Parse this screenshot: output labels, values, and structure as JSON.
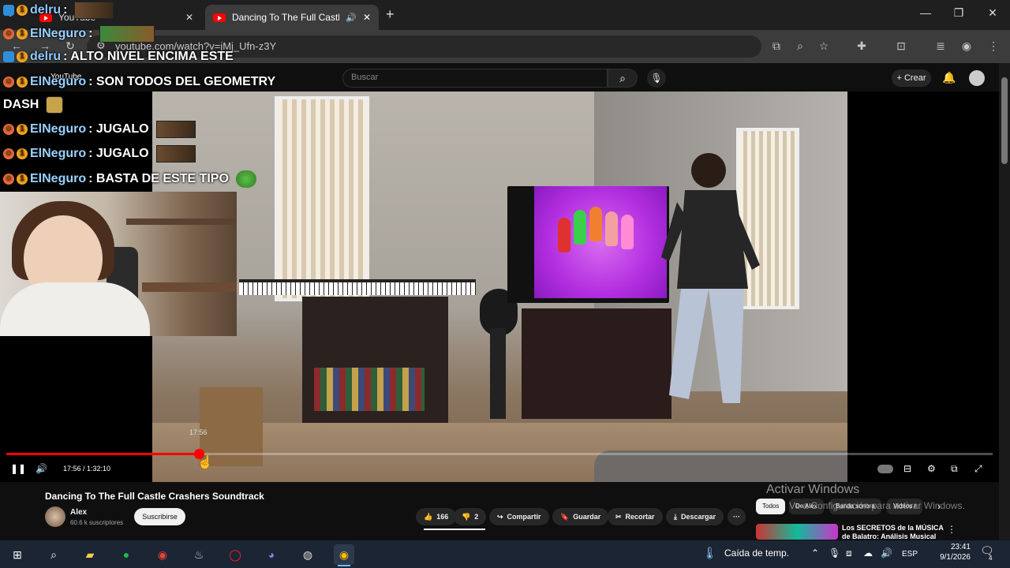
{
  "browser": {
    "tabs": [
      {
        "title": "YouTube"
      },
      {
        "title": "Dancing To The Full Castle C"
      }
    ],
    "new_tab": "+",
    "url": "youtube.com/watch?v=jMj_Ufn-z3Y"
  },
  "youtube": {
    "logo_text": "YouTube",
    "search_placeholder": "Buscar",
    "create_label": "Crear"
  },
  "chat": [
    {
      "user": "delru",
      "msg": ":"
    },
    {
      "user": "ElNeguro",
      "msg": ":"
    },
    {
      "user": "delru",
      "msg": ": ALTO NIVEL ENCIMA ESTE"
    },
    {
      "user": "ElNeguro",
      "msg": ": SON TODOS DEL GEOMETRY"
    },
    {
      "user": "",
      "msg": "DASH"
    },
    {
      "user": "ElNeguro",
      "msg": ": JUGALO"
    },
    {
      "user": "ElNeguro",
      "msg": ": JUGALO"
    },
    {
      "user": "ElNeguro",
      "msg": ": BASTA DE ESTE TIPO"
    }
  ],
  "player": {
    "tooltip_time": "17:56",
    "timecode": "17:56 / 1:32:10",
    "progress_fraction": 0.195
  },
  "video": {
    "title": "Dancing To The Full Castle Crashers Soundtrack",
    "channel": "Alex",
    "subscribers": "60.6 k suscriptores",
    "subscribe_label": "Suscribirse",
    "likes": "166",
    "dislikes": "2",
    "share_label": "Compartir",
    "save_label": "Guardar",
    "clip_label": "Recortar",
    "download_label": "Descargar",
    "more_label": "···"
  },
  "chips": [
    {
      "label": "Todos",
      "selected": true
    },
    {
      "label": "De Alex",
      "selected": false
    },
    {
      "label": "Banda sonora",
      "selected": false
    },
    {
      "label": "Videos r",
      "selected": false
    }
  ],
  "recommendation": {
    "title": "Los SECRETOS de la MÚSICA de Balatro: Análisis Musical"
  },
  "windows_activation": {
    "title": "Activar Windows",
    "subtitle": "Ve a Configuración para activar Windows."
  },
  "taskbar": {
    "weather": "Caída de temp.",
    "language": "ESP",
    "time": "23:41",
    "date": "9/1/2026",
    "notifications": "4"
  },
  "colors": {
    "accent": "#ff0000",
    "chat_username": "#8ec9ff",
    "background": "#0f0f0f"
  }
}
